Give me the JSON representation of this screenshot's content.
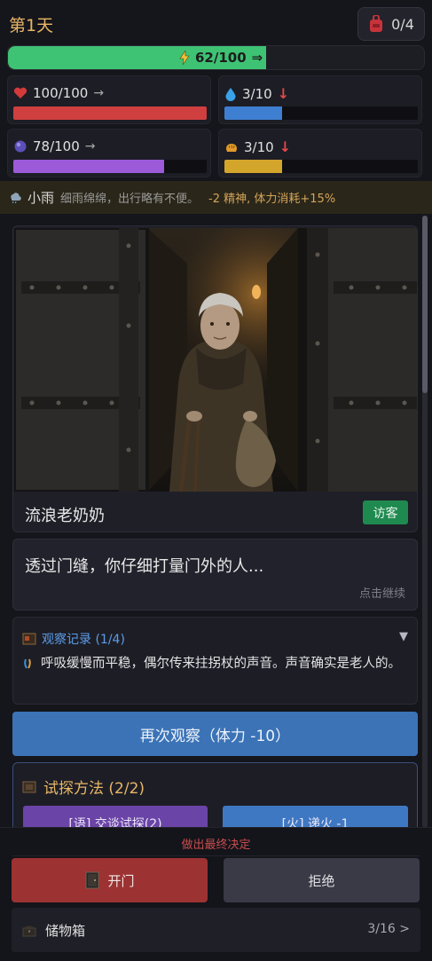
{
  "header": {
    "day_label": "第1天",
    "bag_count": "0/4"
  },
  "energy": {
    "text": "62/100",
    "fraction": 0.62,
    "color": "#3ec274"
  },
  "stats": [
    {
      "icon": "heart-icon",
      "value": "100/100",
      "trend": "→",
      "trend_type": "flat",
      "fraction": 1.0,
      "color": "#cf3f3f"
    },
    {
      "icon": "water-drop-icon",
      "value": "3/10",
      "trend": "↓",
      "trend_type": "down",
      "fraction": 0.3,
      "color": "#3f7fd1"
    },
    {
      "icon": "mind-orb-icon",
      "value": "78/100",
      "trend": "→",
      "trend_type": "flat",
      "fraction": 0.78,
      "color": "#9c5ad9"
    },
    {
      "icon": "bread-icon",
      "value": "3/10",
      "trend": "↓",
      "trend_type": "down",
      "fraction": 0.3,
      "color": "#d4a52b"
    }
  ],
  "weather": {
    "name": "小雨",
    "description": "细雨绵绵，出行略有不便。",
    "effect": "-2 精神, 体力消耗+15%"
  },
  "visitor": {
    "name": "流浪老奶奶",
    "tag": "访客"
  },
  "dialog": {
    "text": "透过门缝，你仔细打量门外的人...",
    "hint": "点击继续"
  },
  "observation": {
    "title": "观察记录 (1/4)",
    "collapse": "▼",
    "text": "呼吸缓慢而平稳，偶尔传来拄拐杖的声音。声音确实是老人的。"
  },
  "reobserve_label": "再次观察（体力 -10）",
  "probe": {
    "title": "试探方法 (2/2)",
    "option_a": "[语] 交谈试探(2)",
    "option_b": "[火] 递火 -1"
  },
  "decision": {
    "label": "做出最终决定",
    "open_label": "开门",
    "reject_label": "拒绝"
  },
  "storage": {
    "label": "储物箱",
    "count": "3/16 >"
  }
}
